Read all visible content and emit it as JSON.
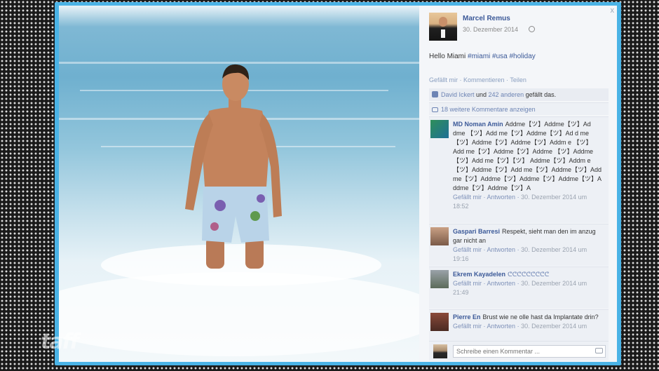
{
  "post": {
    "author": "Marcel Remus",
    "date": "30. Dezember 2014",
    "text_prefix": "Hello Miami ",
    "hashtags": [
      "#miami",
      "#usa",
      "#holiday"
    ],
    "close_label": "x"
  },
  "actions": {
    "like": "Gefällt mir",
    "comment": "Kommentieren",
    "share": "Teilen",
    "separator": " · "
  },
  "likes": {
    "name": "David Ickert",
    "and": " und ",
    "count_text": "242 anderen",
    "suffix": " gefällt das."
  },
  "more_comments": "18 weitere Kommentare anzeigen",
  "comments": [
    {
      "author": "MD Noman Amin",
      "text": "Addme【ツ】Addme【ツ】Ad dme 【ツ】Add me【ツ】Addme【ツ】Ad d me【ツ】Addme【ツ】Addme【ツ】Addm e 【ツ】Add me【ツ】Addme【ツ】Addme 【ツ】Addme【ツ】Add me【ツ】【ツ】 Addme【ツ】Addm e【ツ】Addme【ツ】Add me【ツ】Addme【ツ】Add me【ツ】Addme【ツ】Addme【ツ】Addme【ツ】A ddme【ツ】Addme【ツ】A",
      "like": "Gefällt mir",
      "reply": "Antworten",
      "date": "30. Dezember 2014 um 18:52"
    },
    {
      "author": "Gaspari Barresi",
      "text": "Respekt, sieht man den im anzug gar nicht an",
      "like": "Gefällt mir",
      "reply": "Antworten",
      "date": "30. Dezember 2014 um 19:16"
    },
    {
      "author": "Ekrem Kayadelen",
      "text": "ᕦᕦᕦᕦᕦᕦᕦᕦᕦ",
      "like": "Gefällt mir",
      "reply": "Antworten",
      "date": "30. Dezember 2014 um 21:49"
    },
    {
      "author": "Pierre En",
      "text": "Brust wie ne olle hast da Implantate drin?",
      "like": "Gefällt mir",
      "reply": "Antworten",
      "date": "30. Dezember 2014 um"
    }
  ],
  "comment_input": {
    "placeholder": "Schreibe einen Kommentar ..."
  },
  "watermark": "taff",
  "colors": {
    "frame": "#4ab3e6",
    "link": "#3b5998",
    "panel": "#edf0f5"
  }
}
